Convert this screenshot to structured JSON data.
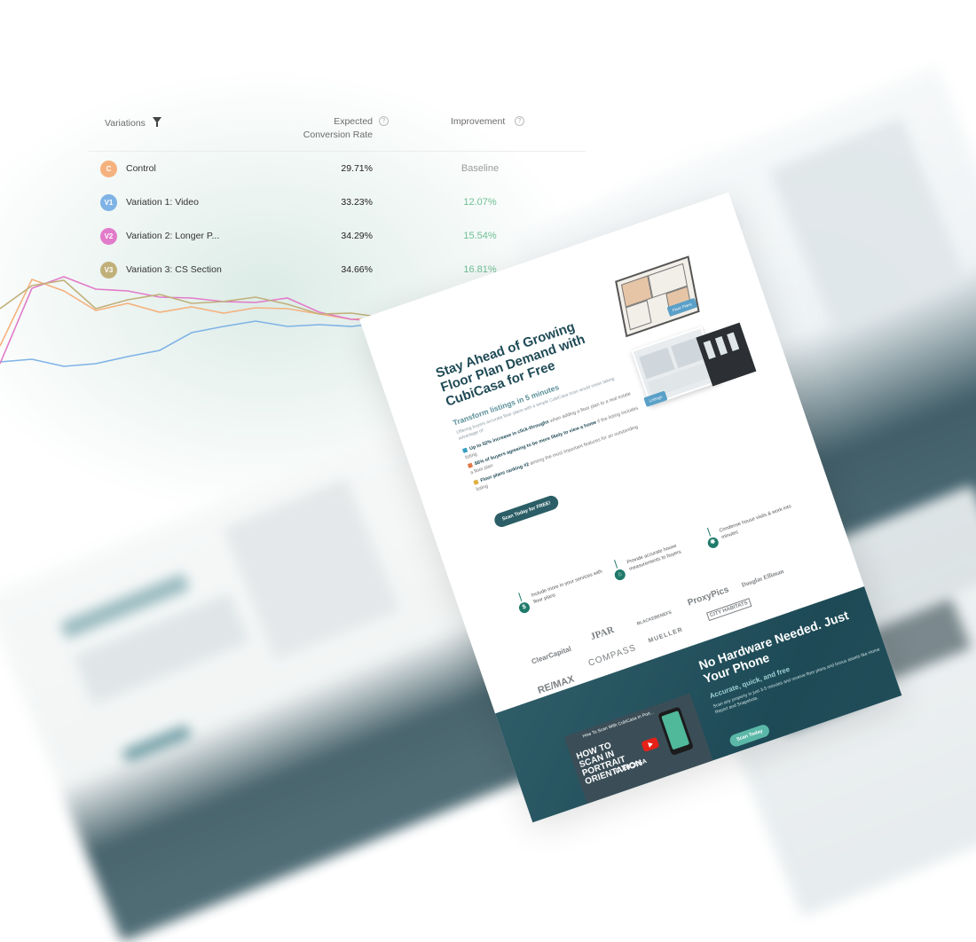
{
  "table": {
    "headers": {
      "variations": "Variations",
      "rate_line1": "Expected",
      "rate_line2": "Conversion Rate",
      "improvement": "Improvement"
    },
    "rows": [
      {
        "badge": "C",
        "badge_color": "#f5b27e",
        "name": "Control",
        "rate": "29.71%",
        "improvement": "Baseline",
        "imp_color": "#9a9a9a"
      },
      {
        "badge": "V1",
        "badge_color": "#7fb3e6",
        "name": "Variation 1: Video",
        "rate": "33.23%",
        "improvement": "12.07%",
        "imp_color": "#6fbf94"
      },
      {
        "badge": "V2",
        "badge_color": "#e27bc9",
        "name": "Variation 2: Longer P...",
        "rate": "34.29%",
        "improvement": "15.54%",
        "imp_color": "#6fbf94"
      },
      {
        "badge": "V3",
        "badge_color": "#c1b07a",
        "name": "Variation 3: CS Section",
        "rate": "34.66%",
        "improvement": "16.81%",
        "imp_color": "#6fbf94"
      }
    ]
  },
  "chart_data": {
    "type": "line",
    "series": [
      {
        "color": "#f5b27e",
        "values": [
          420,
          345,
          358,
          380,
          372,
          382,
          376,
          383,
          377,
          378,
          384,
          390,
          388,
          386,
          385,
          377,
          370,
          364,
          356,
          352
        ]
      },
      {
        "color": "#7fb3e6",
        "values": [
          438,
          435,
          443,
          440,
          432,
          425,
          405,
          398,
          392,
          398,
          396,
          398,
          394,
          395,
          388,
          389,
          384,
          380
        ]
      },
      {
        "color": "#e27bc9",
        "values": [
          440,
          355,
          342,
          356,
          358,
          365,
          366,
          370,
          371,
          366,
          382,
          390,
          392,
          396,
          396,
          387,
          378,
          368,
          360,
          356,
          358
        ]
      },
      {
        "color": "#c1b07a",
        "values": [
          378,
          352,
          346,
          378,
          368,
          362,
          372,
          370,
          365,
          373,
          384,
          383,
          388,
          382,
          386,
          380,
          368,
          362,
          356,
          344,
          343
        ]
      }
    ]
  },
  "landing": {
    "hero_title": "Stay Ahead of Growing Floor Plan Demand with CubiCasa for Free",
    "hero_sub": "Transform listings in 5 minutes",
    "hero_intro": "Offering buyers accurate floor plans with a simple CubiCasa scan would mean taking advantage of:",
    "bullets": [
      {
        "bold": "Up to 52% increase in click-throughs",
        "rest": " when adding a floor plan to a real estate listing"
      },
      {
        "bold": "86% of buyers agreeing to be more likely to view a home",
        "rest": " if the listing includes a floor plan"
      },
      {
        "bold": "Floor plans ranking #2",
        "rest": " among the most important features for an outstanding listing"
      }
    ],
    "cta": "Scan Today for FREE!",
    "floor_plans_tag": "Floor Plans",
    "listings_tag": "Listings",
    "features": [
      "Include more in your services with floor plans",
      "Provide accurate house measurements to buyers",
      "Condense house visits & work into minutes"
    ],
    "logos": [
      "ProxyPics",
      "Douglas Elliman",
      "BLACKEBENEFS",
      "ClearCapital",
      "JPAR",
      "COMPASS",
      "MUELLER",
      "CITY HABITATS",
      "RE/MAX"
    ],
    "dark_title": "No Hardware Needed. Just Your Phone",
    "dark_sub": "Accurate, quick, and free",
    "dark_body": "Scan any property in just 3-5 minutes and receive floor plans and bonus assets like Home Report and Snapshots.",
    "dark_cta": "Scan Today",
    "video_title": "How To Scan With CubiCasa In Port...",
    "video_how": "HOW TO SCAN IN PORTRAIT ORIENTATION",
    "video_brand": "CUBICASA"
  }
}
